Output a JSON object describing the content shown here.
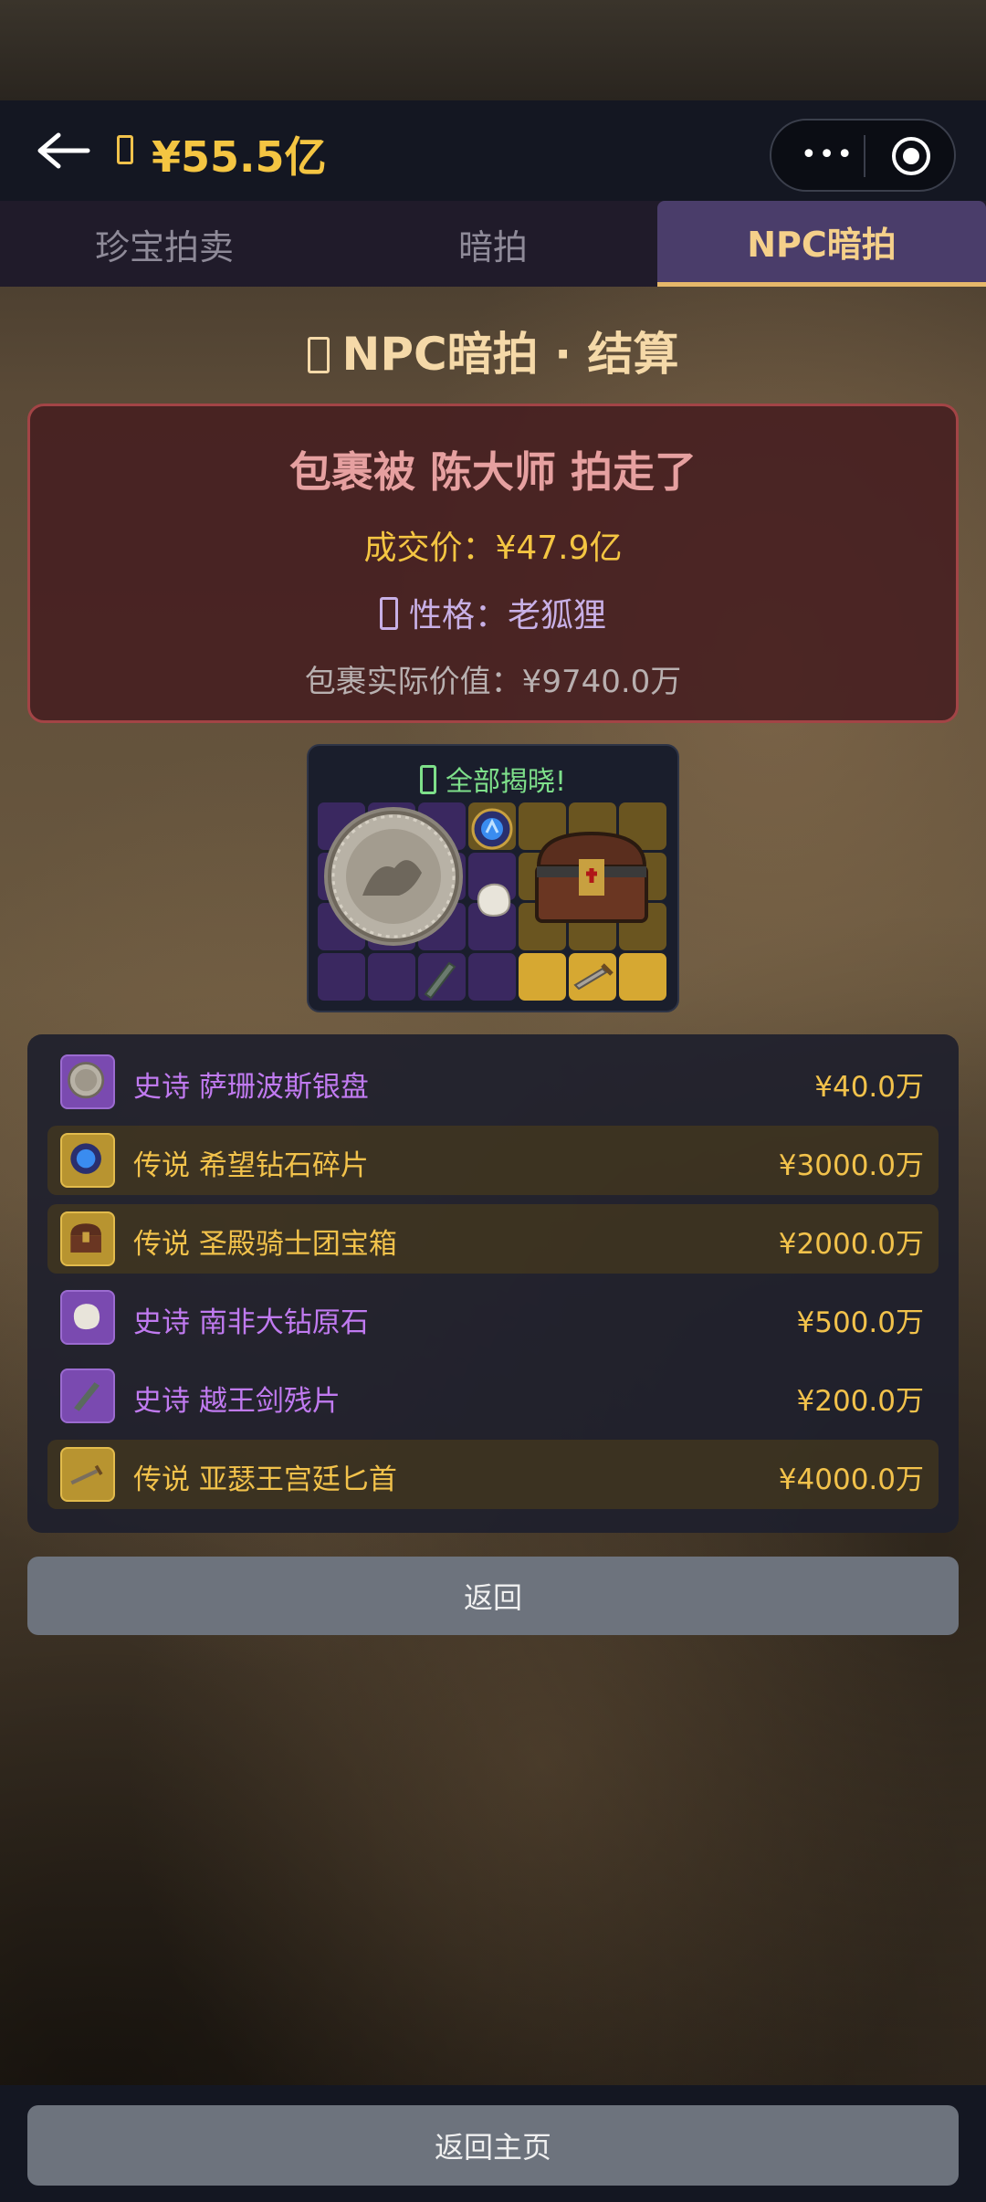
{
  "header": {
    "back_icon": "back-arrow-icon",
    "money_icon": "money-icon",
    "balance": "¥55.5亿",
    "menu_icon": "more-dots-icon",
    "close_icon": "target-icon"
  },
  "tabs": [
    {
      "label": "珍宝拍卖",
      "active": false
    },
    {
      "label": "暗拍",
      "active": false
    },
    {
      "label": "NPC暗拍",
      "active": true
    }
  ],
  "page_title": "NPC暗拍 · 结算",
  "result": {
    "winner_text": "包裹被 陈大师 拍走了",
    "deal_price": "成交价：¥47.9亿",
    "personality": "性格：老狐狸",
    "actual_value": "包裹实际价值：¥9740.0万",
    "colors": {
      "border": "#a34446",
      "winner": "#e6a0a0",
      "price": "#f4c542"
    }
  },
  "reveal": {
    "title": "全部揭晓!",
    "items": [
      {
        "name": "silver-plate",
        "rarity": "epic"
      },
      {
        "name": "diamond-fragment",
        "rarity": "legendary"
      },
      {
        "name": "knights-chest",
        "rarity": "legendary"
      },
      {
        "name": "rough-diamond",
        "rarity": "epic"
      },
      {
        "name": "sword-fragment",
        "rarity": "epic"
      },
      {
        "name": "dagger",
        "rarity": "legendary"
      }
    ]
  },
  "items": [
    {
      "rarity": "史诗",
      "name": "萨珊波斯银盘",
      "value": "¥40.0万",
      "tier": "epic",
      "icon": "silver-plate-icon"
    },
    {
      "rarity": "传说",
      "name": "希望钻石碎片",
      "value": "¥3000.0万",
      "tier": "legendary",
      "icon": "blue-diamond-icon"
    },
    {
      "rarity": "传说",
      "name": "圣殿骑士团宝箱",
      "value": "¥2000.0万",
      "tier": "legendary",
      "icon": "treasure-chest-icon"
    },
    {
      "rarity": "史诗",
      "name": "南非大钻原石",
      "value": "¥500.0万",
      "tier": "epic",
      "icon": "rough-stone-icon"
    },
    {
      "rarity": "史诗",
      "name": "越王剑残片",
      "value": "¥200.0万",
      "tier": "epic",
      "icon": "sword-fragment-icon"
    },
    {
      "rarity": "传说",
      "name": "亚瑟王宫廷匕首",
      "value": "¥4000.0万",
      "tier": "legendary",
      "icon": "dagger-icon"
    }
  ],
  "buttons": {
    "return": "返回",
    "home": "返回主页"
  },
  "colors": {
    "epic": "#c07af0",
    "legendary": "#f2c24b",
    "tab_active_bg": "#4a3d6a",
    "button_bg": "#6d737d"
  }
}
